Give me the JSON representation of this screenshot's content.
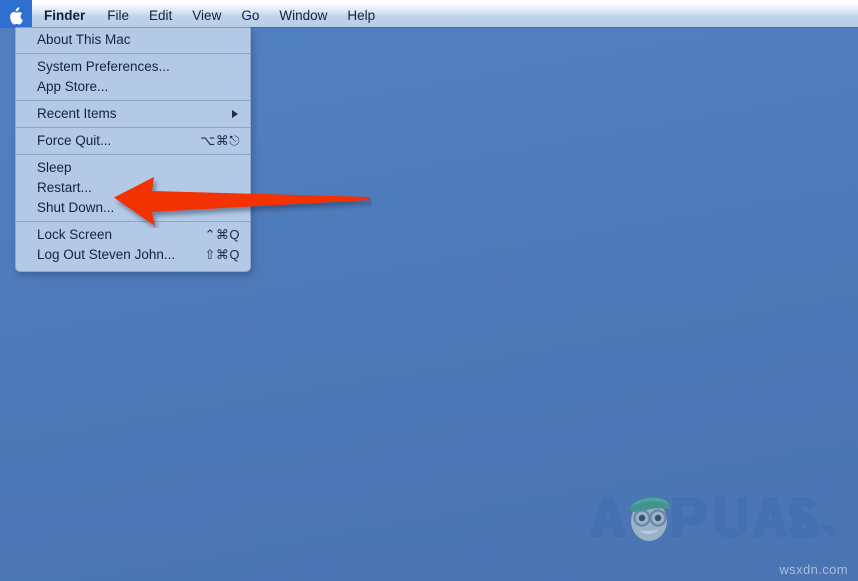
{
  "os": "macOS",
  "colors": {
    "desktop_blue": "#4f7cbc",
    "menubar_blue": "#b9cfe8",
    "menu_background": "#b3c9e6",
    "apple_highlight": "#2f6fd0",
    "menu_text": "#15233f",
    "arrow_red": "#f23105",
    "separator": "#8ba7cb"
  },
  "menubar": {
    "apple_icon": "apple-logo-icon",
    "items": [
      {
        "label": "Finder",
        "bold": true
      },
      {
        "label": "File",
        "bold": false
      },
      {
        "label": "Edit",
        "bold": false
      },
      {
        "label": "View",
        "bold": false
      },
      {
        "label": "Go",
        "bold": false
      },
      {
        "label": "Window",
        "bold": false
      },
      {
        "label": "Help",
        "bold": false
      }
    ]
  },
  "apple_menu": {
    "groups": [
      {
        "items": [
          {
            "label": "About This Mac",
            "shortcut": "",
            "submenu": false
          }
        ]
      },
      {
        "items": [
          {
            "label": "System Preferences...",
            "shortcut": "",
            "submenu": false
          },
          {
            "label": "App Store...",
            "shortcut": "",
            "submenu": false
          }
        ]
      },
      {
        "items": [
          {
            "label": "Recent Items",
            "shortcut": "",
            "submenu": true
          }
        ]
      },
      {
        "items": [
          {
            "label": "Force Quit...",
            "shortcut": "⌥⌘⎋",
            "submenu": false
          }
        ]
      },
      {
        "items": [
          {
            "label": "Sleep",
            "shortcut": "",
            "submenu": false
          },
          {
            "label": "Restart...",
            "shortcut": "",
            "submenu": false
          },
          {
            "label": "Shut Down...",
            "shortcut": "",
            "submenu": false
          }
        ]
      },
      {
        "items": [
          {
            "label": "Lock Screen",
            "shortcut": "⌃⌘Q",
            "submenu": false
          },
          {
            "label": "Log Out Steven John...",
            "shortcut": "⇧⌘Q",
            "submenu": false
          }
        ]
      }
    ]
  },
  "annotation": {
    "arrow": "red-left-arrow-pointing-at-restart",
    "points_to": "Restart..."
  },
  "watermarks": {
    "brand": "APPUALS",
    "site": "wsxdn.com"
  }
}
